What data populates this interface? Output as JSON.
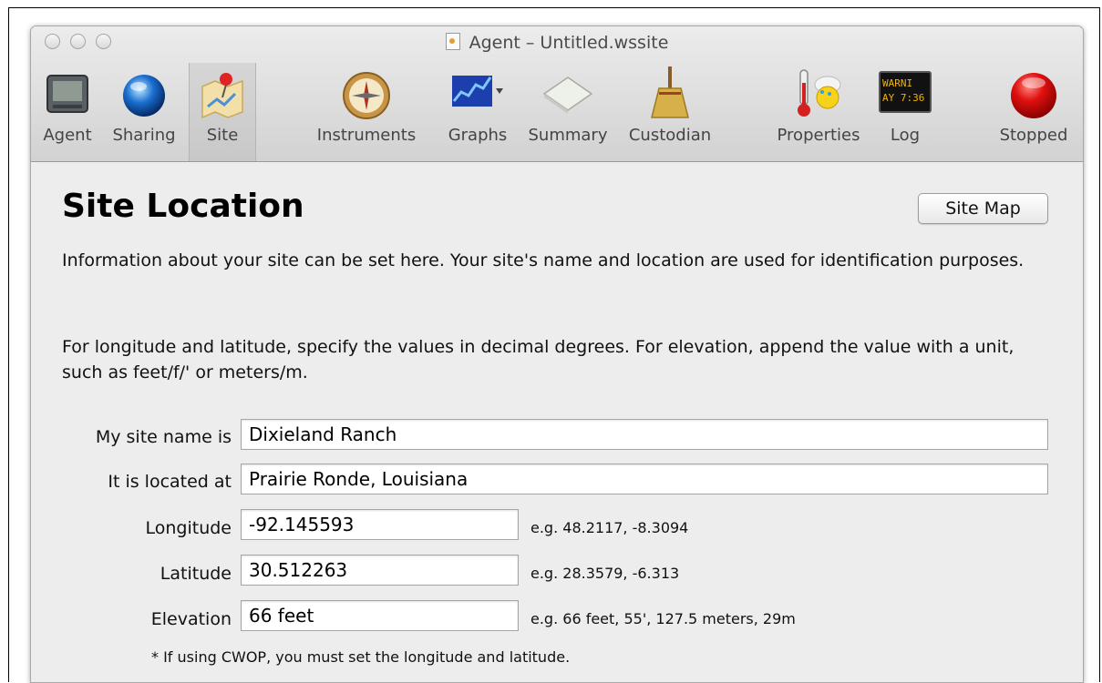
{
  "window": {
    "title": "Agent – Untitled.wssite"
  },
  "toolbar": {
    "items": [
      {
        "label": "Agent",
        "icon": "agent-device-icon"
      },
      {
        "label": "Sharing",
        "icon": "globe-icon"
      },
      {
        "label": "Site",
        "icon": "map-pin-icon"
      },
      {
        "label": "Instruments",
        "icon": "compass-icon"
      },
      {
        "label": "Graphs",
        "icon": "graph-icon"
      },
      {
        "label": "Summary",
        "icon": "summary-paper-icon"
      },
      {
        "label": "Custodian",
        "icon": "broom-icon"
      },
      {
        "label": "Properties",
        "icon": "thermometer-icon"
      },
      {
        "label": "Log",
        "icon": "log-display-icon",
        "display_lines": [
          "WARNI",
          "AY 7:36"
        ]
      },
      {
        "label": "Stopped",
        "icon": "stop-status-icon"
      }
    ],
    "selected": "Site"
  },
  "page": {
    "heading": "Site Location",
    "site_map_button": "Site Map",
    "intro": "Information about your site can be set here. Your site's name and location are used for identification purposes.",
    "instructions": "For longitude and latitude, specify the values in decimal degrees. For elevation, append the value with a unit, such as feet/f/' or meters/m."
  },
  "form": {
    "name_label": "My site name is",
    "name_value": "Dixieland Ranch",
    "location_label": "It is located at",
    "location_value": "Prairie Ronde, Louisiana",
    "longitude_label": "Longitude",
    "longitude_value": "-92.145593",
    "longitude_hint": "e.g. 48.2117, -8.3094",
    "latitude_label": "Latitude",
    "latitude_value": "30.512263",
    "latitude_hint": "e.g. 28.3579, -6.313",
    "elevation_label": "Elevation",
    "elevation_value": "66 feet",
    "elevation_hint": "e.g. 66 feet, 55', 127.5 meters, 29m",
    "cwop_note": "* If using CWOP, you must set the longitude and latitude."
  },
  "colors": {
    "stop_red": "#e01010",
    "globe_blue": "#1a6fd0",
    "window_bg": "#ededed"
  }
}
